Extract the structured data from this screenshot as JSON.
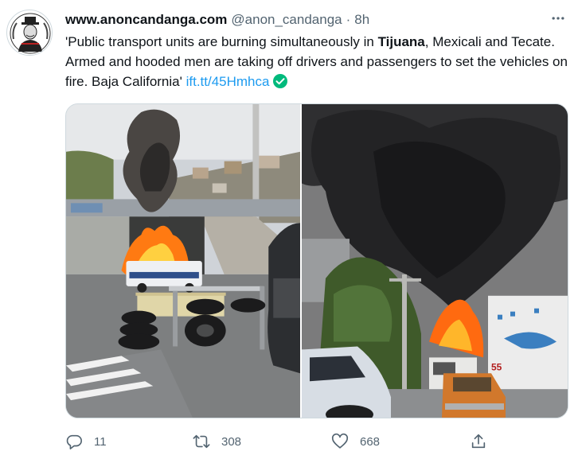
{
  "tweet": {
    "display_name": "www.anoncandanga.com",
    "handle": "@anon_candanga",
    "separator": "·",
    "time": "8h",
    "text_parts": {
      "part1": "'Public transport units are burning simultaneously in ",
      "bold": "Tijuana",
      "part2": ", Mexicali and Tecate.  Armed and hooded men are taking off drivers and passengers to set the vehicles on fire.  Baja California' ",
      "link": "ift.tt/45Hmhca"
    },
    "photo_left_plate": "55"
  },
  "stats": {
    "replies": "11",
    "retweets": "308",
    "likes": "668"
  },
  "icons": {
    "avatar": "anonymous-mask-avatar",
    "more": "more-icon",
    "verified": "verified-badge-icon",
    "reply": "reply-icon",
    "retweet": "retweet-icon",
    "like": "heart-icon",
    "share": "share-icon"
  },
  "colors": {
    "link": "#1d9bf0",
    "verified": "#00ba7c",
    "secondary_text": "#536471"
  }
}
